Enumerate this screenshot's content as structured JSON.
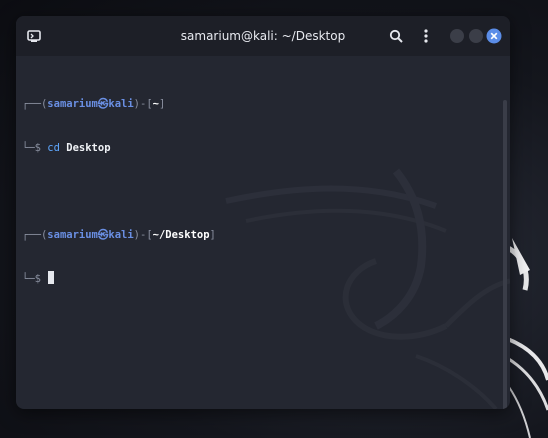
{
  "window": {
    "title": "samarium@kali: ~/Desktop"
  },
  "titlebar_icons": {
    "app_icon": "terminal-app-icon",
    "search_icon": "search-icon",
    "menu_icon": "kebab-menu-icon",
    "minimize": "minimize-circle",
    "maximize": "maximize-circle",
    "close": "close-icon"
  },
  "terminal": {
    "line1": {
      "frame_open": "┌──(",
      "user": "samarium",
      "at": "㉿",
      "host": "kali",
      "frame_mid": ")-[",
      "path": "~",
      "frame_close": "]"
    },
    "line2": {
      "prompt": "└─$ ",
      "command": "cd",
      "argument": " Desktop"
    },
    "line3": {
      "frame_open": "┌──(",
      "user": "samarium",
      "at": "㉿",
      "host": "kali",
      "frame_mid": ")-[",
      "path": "~/Desktop",
      "frame_close": "]"
    },
    "line4": {
      "prompt": "└─$ "
    }
  },
  "colors": {
    "accent_blue": "#6a8fe3",
    "close_button": "#5b8de8",
    "window_bg": "#242731",
    "titlebar_bg": "#1d1f27"
  }
}
